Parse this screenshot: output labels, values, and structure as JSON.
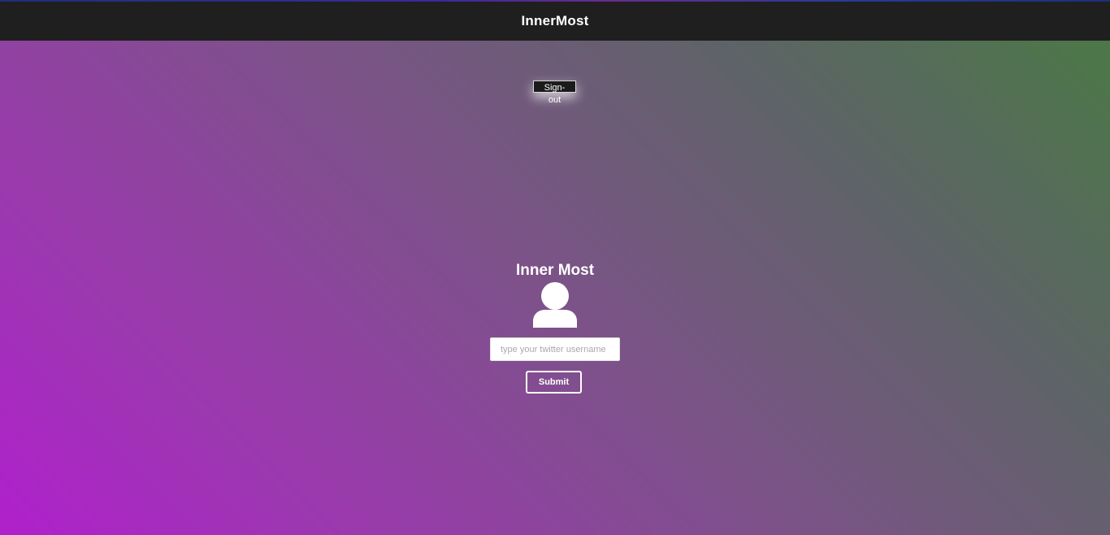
{
  "navbar": {
    "brand": "InnerMost"
  },
  "signout": {
    "label": "Sign-out"
  },
  "profile": {
    "title": "Inner Most",
    "avatar_icon": "user-avatar-icon"
  },
  "form": {
    "username_placeholder": "type your twitter username",
    "username_value": "",
    "submit_label": "Submit"
  },
  "colors": {
    "navbar_bg": "#1f1f1f",
    "gradient_green": "#4a7a44",
    "gradient_purple": "#b020cc"
  }
}
